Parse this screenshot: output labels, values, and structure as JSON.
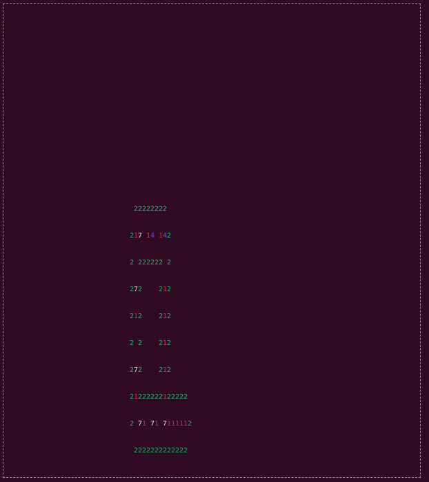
{
  "colors": {
    "background": "#300a24",
    "border": "#b48aa6",
    "digit_2": "#2bb673",
    "digit_1": "#e02a3b",
    "digit_7": "#e6e6e6",
    "digit_4": "#6b4fe0"
  },
  "terminal": {
    "grid_lines": [
      " 22222222",
      "217 14 142",
      "2 222222 2",
      "272    212",
      "212    212",
      "2 2    212",
      "272    212",
      "21222222122222",
      "2 71 71 7111112",
      " 2222222222222"
    ]
  }
}
